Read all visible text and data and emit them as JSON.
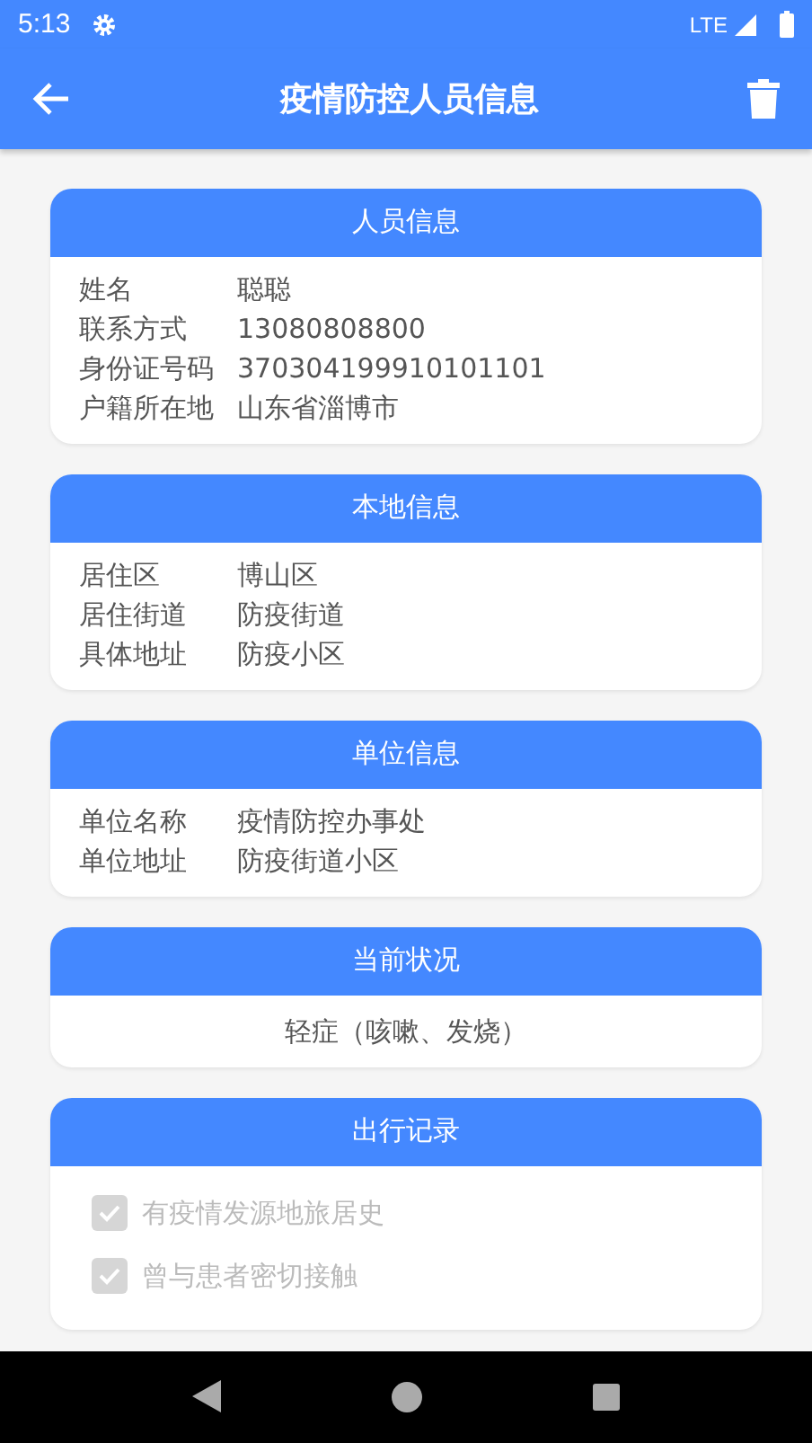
{
  "status_bar": {
    "time": "5:13",
    "network": "LTE"
  },
  "app_bar": {
    "title": "疫情防控人员信息"
  },
  "sections": [
    {
      "kind": "fields",
      "title": "人员信息",
      "fields": [
        {
          "label": "姓名",
          "value": "聪聪"
        },
        {
          "label": "联系方式",
          "value": "13080808800"
        },
        {
          "label": "身份证号码",
          "value": "370304199910101101"
        },
        {
          "label": "户籍所在地",
          "value": "山东省淄博市"
        }
      ]
    },
    {
      "kind": "fields",
      "title": "本地信息",
      "fields": [
        {
          "label": "居住区",
          "value": "博山区"
        },
        {
          "label": "居住街道",
          "value": "防疫街道"
        },
        {
          "label": "具体地址",
          "value": "防疫小区"
        }
      ]
    },
    {
      "kind": "fields",
      "title": "单位信息",
      "fields": [
        {
          "label": "单位名称",
          "value": "疫情防控办事处"
        },
        {
          "label": "单位地址",
          "value": "防疫街道小区"
        }
      ]
    },
    {
      "kind": "text",
      "title": "当前状况",
      "text": "轻症（咳嗽、发烧）"
    },
    {
      "kind": "checks",
      "title": "出行记录",
      "checks": [
        {
          "label": "有疫情发源地旅居史",
          "checked": true,
          "disabled": true
        },
        {
          "label": "曾与患者密切接触",
          "checked": true,
          "disabled": true
        }
      ]
    }
  ]
}
